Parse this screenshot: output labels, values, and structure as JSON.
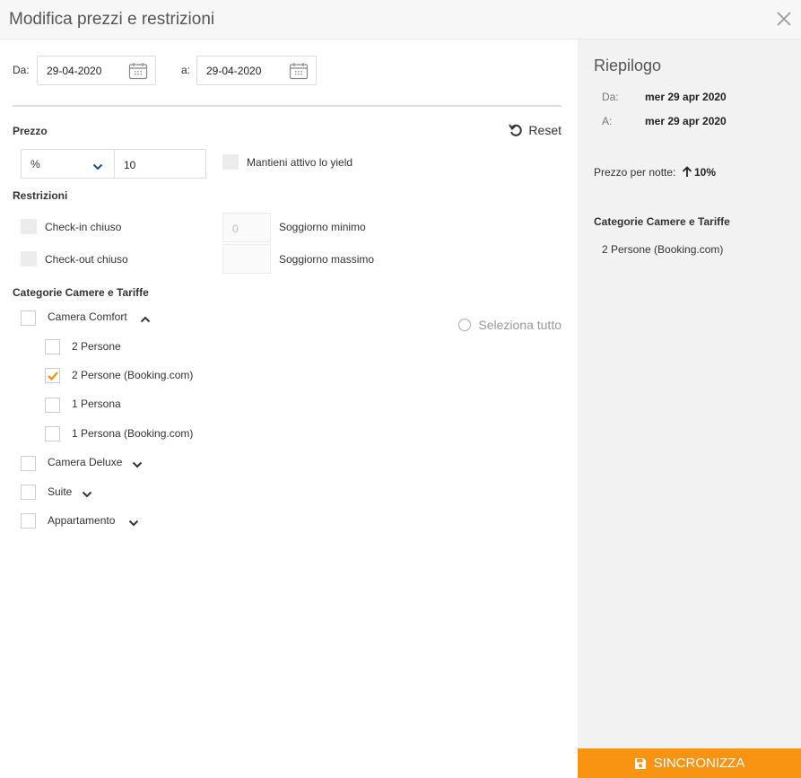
{
  "header": {
    "title": "Modifica prezzi e restrizioni"
  },
  "dates": {
    "from_label": "Da:",
    "from_value": "29-04-2020",
    "to_label": "a:",
    "to_value": "29-04-2020"
  },
  "price": {
    "heading": "Prezzo",
    "reset_label": "Reset",
    "unit_value": "%",
    "amount_value": "10",
    "keep_yield_label": "Mantieni attivo lo yield"
  },
  "restrictions": {
    "heading": "Restrizioni",
    "checkin_closed_label": "Check-in chiuso",
    "checkout_closed_label": "Check-out chiuso",
    "min_stay_placeholder": "0",
    "min_stay_label": "Soggiorno minimo",
    "max_stay_label": "Soggiorno massimo"
  },
  "categories": {
    "heading": "Categorie Camere e Tariffe",
    "select_all_label": "Seleziona tutto",
    "rooms": [
      {
        "label": "Camera Comfort",
        "expanded": true,
        "rates": [
          {
            "label": "2 Persone",
            "checked": false
          },
          {
            "label": "2 Persone (Booking.com)",
            "checked": true
          },
          {
            "label": "1 Persona",
            "checked": false
          },
          {
            "label": "1 Persona (Booking.com)",
            "checked": false
          }
        ]
      },
      {
        "label": "Camera Deluxe",
        "expanded": false
      },
      {
        "label": "Suite",
        "expanded": false
      },
      {
        "label": "Appartamento",
        "expanded": false
      }
    ]
  },
  "summary": {
    "title": "Riepilogo",
    "from_label": "Da:",
    "from_value": "mer 29 apr 2020",
    "to_label": "A:",
    "to_value": "mer 29 apr 2020",
    "price_label": "Prezzo per notte:",
    "price_value": "10%",
    "categories_heading": "Categorie Camere e Tariffe",
    "selected_rate": "2 Persone (Booking.com)",
    "sync_label": "SINCRONIZZA"
  },
  "colors": {
    "accent": "#f89412",
    "sidebar_bg": "#f2f2f2",
    "header_bg": "#f7f7f7"
  }
}
